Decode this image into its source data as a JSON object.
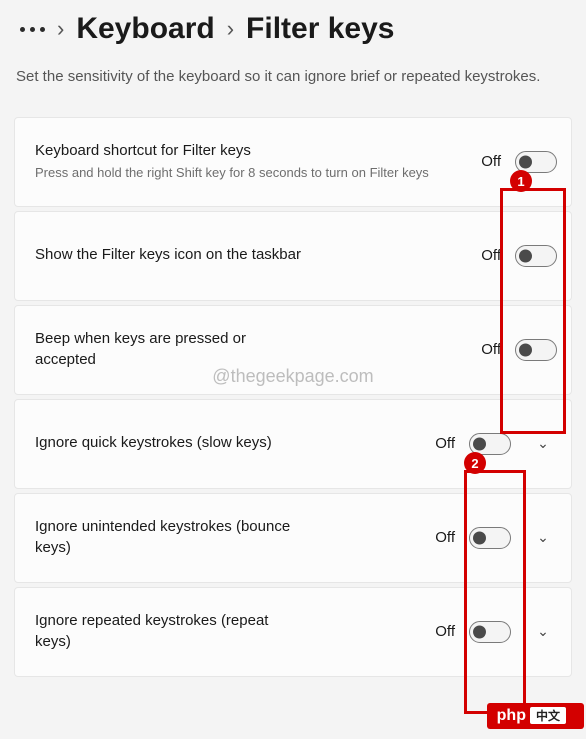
{
  "breadcrumb": {
    "parent": "Keyboard",
    "current": "Filter keys"
  },
  "description": "Set the sensitivity of the keyboard so it can ignore brief or repeated keystrokes.",
  "settings": [
    {
      "title": "Keyboard shortcut for Filter keys",
      "sub": "Press and hold the right Shift key for 8 seconds to turn on Filter keys",
      "state": "Off",
      "expandable": false
    },
    {
      "title": "Show the Filter keys icon on the taskbar",
      "sub": "",
      "state": "Off",
      "expandable": false
    },
    {
      "title": "Beep when keys are pressed or accepted",
      "sub": "",
      "state": "Off",
      "expandable": false
    },
    {
      "title": "Ignore quick keystrokes (slow keys)",
      "sub": "",
      "state": "Off",
      "expandable": true
    },
    {
      "title": "Ignore unintended keystrokes (bounce keys)",
      "sub": "",
      "state": "Off",
      "expandable": true
    },
    {
      "title": "Ignore repeated keystrokes (repeat keys)",
      "sub": "",
      "state": "Off",
      "expandable": true
    }
  ],
  "watermark": "@thegeekpage.com",
  "annotations": {
    "badge1": "1",
    "badge2": "2"
  },
  "footer_badge": {
    "brand": "php",
    "cn": "中文"
  }
}
